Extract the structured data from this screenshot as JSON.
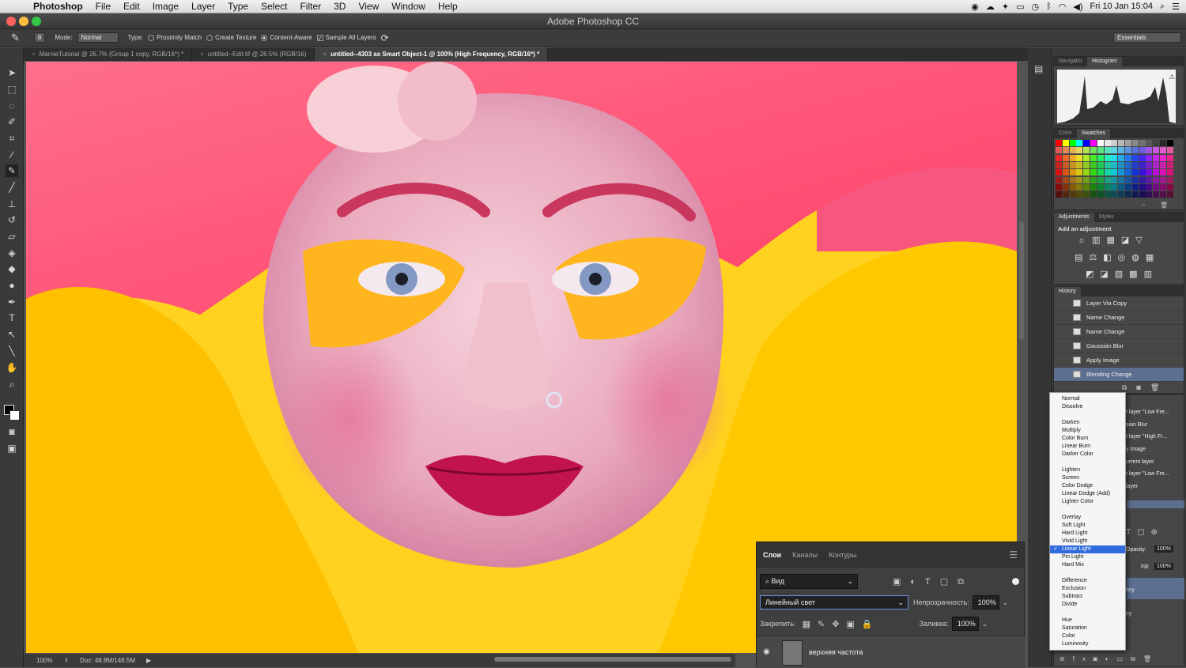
{
  "menubar": {
    "app": "Photoshop",
    "items": [
      "File",
      "Edit",
      "Image",
      "Layer",
      "Type",
      "Select",
      "Filter",
      "3D",
      "View",
      "Window",
      "Help"
    ],
    "clock": "Fri 10 Jan  15:04"
  },
  "window": {
    "title": "Adobe Photoshop CC"
  },
  "options": {
    "mode_label": "Mode:",
    "mode_value": "Normal",
    "type_label": "Type:",
    "proximity": "Proximity Match",
    "texture": "Create Texture",
    "content_aware": "Content-Aware",
    "sample_all": "Sample All Layers",
    "brush_size": "8",
    "workspace": "Essentials"
  },
  "tabs": [
    {
      "label": "MarnieTutorial @ 26.7% (Group 1 copy, RGB/16*) *"
    },
    {
      "label": "untitled--Edit.tif @ 26.5% (RGB/16)"
    },
    {
      "label": "untitled--4303 as Smart Object-1 @ 100% (High Frequency, RGB/16*) *"
    }
  ],
  "status": {
    "zoom": "100%",
    "doc": "Doc: 48.8M/146.5M"
  },
  "panels": {
    "nav_tabs": [
      "Navigator",
      "Histogram"
    ],
    "color_tabs": [
      "Color",
      "Swatches"
    ],
    "adj_tabs": [
      "Adjustments",
      "Styles"
    ],
    "add_adjustment": "Add an adjustment",
    "history_title": "History",
    "history": [
      "Layer Via Copy",
      "Name Change",
      "Name Change",
      "Gaussian Blur",
      "Apply Image",
      "Blending Change"
    ],
    "layer_fragments": [
      "t layer \"Low Fre...",
      "sian Blur",
      "t layer \"High Fr...",
      "y Image",
      "urrent layer",
      "t layer \"Low Fre...",
      "layer"
    ],
    "opacity_label": "Opacity:",
    "opacity_value": "100%",
    "fill_label": "Fill:",
    "fill_value": "100%",
    "cy1": "ncy",
    "cy2": "cy"
  },
  "blend_menu": {
    "groups": [
      [
        "Normal",
        "Dissolve"
      ],
      [
        "Darken",
        "Multiply",
        "Color Burn",
        "Linear Burn",
        "Darker Color"
      ],
      [
        "Lighten",
        "Screen",
        "Color Dodge",
        "Linear Dodge (Add)",
        "Lighter Color"
      ],
      [
        "Overlay",
        "Soft Light",
        "Hard Light",
        "Vivid Light",
        "Linear Light",
        "Pin Light",
        "Hard Mix"
      ],
      [
        "Difference",
        "Exclusion",
        "Subtract",
        "Divide"
      ],
      [
        "Hue",
        "Saturation",
        "Color",
        "Luminosity"
      ]
    ],
    "selected": "Linear Light"
  },
  "layers_panel": {
    "tabs": [
      "Слои",
      "Каналы",
      "Контуры"
    ],
    "filter": "Вид",
    "blend_mode": "Линейный свет",
    "opacity_label": "Непрозрачность:",
    "opacity_value": "100%",
    "lock_label": "Закрепить:",
    "fill_label": "Заливка:",
    "fill_value": "100%",
    "layer_name": "верхняя частота"
  },
  "colors": {
    "accent": "#2f6bdc",
    "selection": "#5c6f90",
    "background": "#535353"
  }
}
